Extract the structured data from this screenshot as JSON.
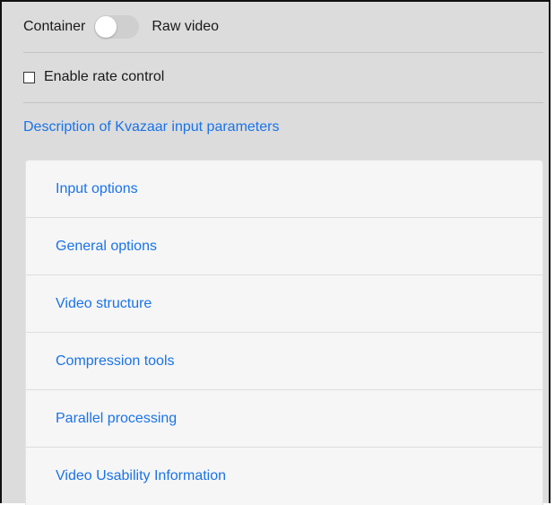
{
  "format_row": {
    "left_label": "Container",
    "right_label": "Raw video",
    "toggle_state": "off"
  },
  "rate_control": {
    "label": "Enable rate control",
    "checked": false
  },
  "description_link": "Description of Kvazaar input parameters",
  "sections": [
    {
      "label": "Input options"
    },
    {
      "label": "General options"
    },
    {
      "label": "Video structure"
    },
    {
      "label": "Compression tools"
    },
    {
      "label": "Parallel processing"
    },
    {
      "label": "Video Usability Information"
    }
  ],
  "colors": {
    "link": "#1a73e8",
    "background": "#dcdcdc",
    "panel": "#f6f6f6"
  }
}
